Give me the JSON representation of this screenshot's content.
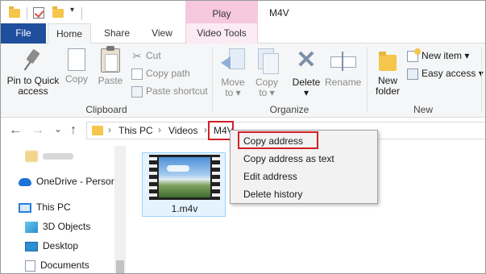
{
  "window": {
    "title": "M4V",
    "contextual_tab_group": "Play"
  },
  "quick_access": {
    "icons": [
      "folder-icon",
      "properties-check-icon",
      "new-folder-icon",
      "customize-dropdown-icon"
    ],
    "dropdown_glyph": "▾"
  },
  "tabs": {
    "file": "File",
    "home": "Home",
    "share": "Share",
    "view": "View",
    "video_tools": "Video Tools"
  },
  "ribbon": {
    "clipboard": {
      "pin_label": "Pin to Quick access",
      "pin_line1": "Pin to Quick",
      "pin_line2": "access",
      "copy": "Copy",
      "paste": "Paste",
      "cut": "Cut",
      "copy_path": "Copy path",
      "paste_shortcut": "Paste shortcut",
      "group_label": "Clipboard"
    },
    "organize": {
      "move_to": "Move to",
      "move_line1": "Move",
      "move_line2": "to ▾",
      "copy_line1": "Copy",
      "copy_line2": "to ▾",
      "delete": "Delete",
      "delete_arrow": "▾",
      "rename": "Rename",
      "group_label": "Organize"
    },
    "new": {
      "folder_line1": "New",
      "folder_line2": "folder",
      "new_item": "New item ▾",
      "easy_access": "Easy access ▾",
      "group_label": "New"
    }
  },
  "navigation": {
    "back": "←",
    "forward": "→",
    "recent": "⌄",
    "up": "↑"
  },
  "address_bar": {
    "chev": "›",
    "segments": [
      "This PC",
      "Videos",
      "M4V"
    ],
    "current": "M4V"
  },
  "nav_pane": {
    "items": [
      {
        "label": "",
        "icon": "blurred-folder-icon",
        "blurred": true
      },
      {
        "label": "OneDrive - Persor",
        "icon": "onedrive-cloud-icon"
      },
      {
        "label": "This PC",
        "icon": "this-pc-icon"
      },
      {
        "label": "3D Objects",
        "icon": "3d-objects-icon"
      },
      {
        "label": "Desktop",
        "icon": "desktop-icon"
      },
      {
        "label": "Documents",
        "icon": "documents-icon"
      }
    ]
  },
  "files": [
    {
      "name": "1.m4v",
      "icon": "video-thumbnail-icon",
      "selected": true
    }
  ],
  "context_menu": {
    "items": [
      "Copy address",
      "Copy address as text",
      "Edit address",
      "Delete history"
    ],
    "highlighted": "Copy address"
  },
  "colors": {
    "file_tab": "#1e4e9c",
    "play_tab": "#f6c8de",
    "highlight_box": "#d02027",
    "folder": "#f4c64b",
    "selection": "#e5f3ff"
  }
}
